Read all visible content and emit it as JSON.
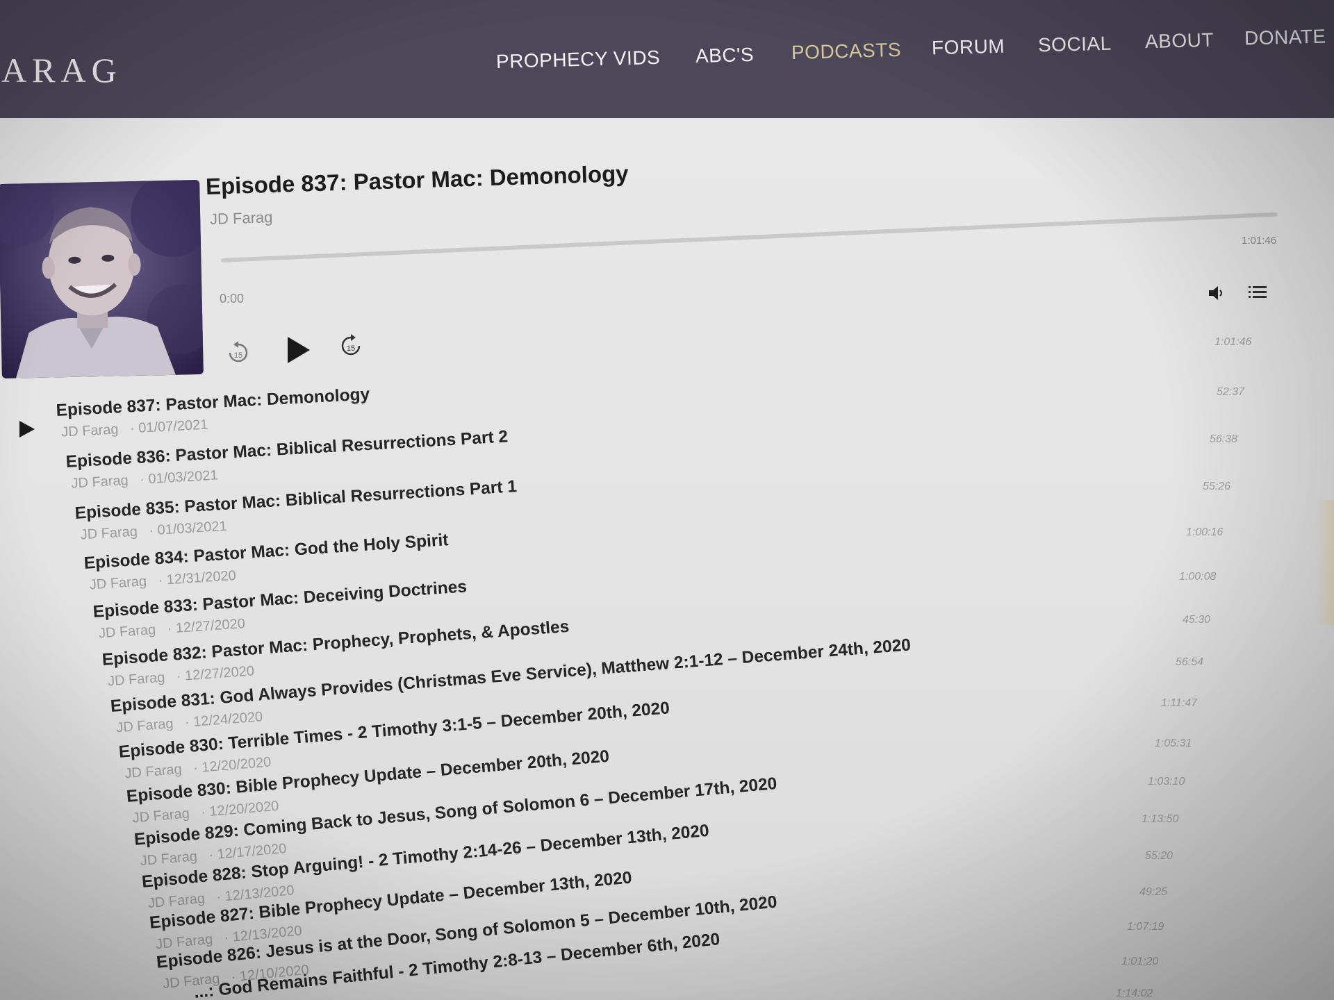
{
  "header": {
    "logo": "ARAG",
    "nav": [
      {
        "label": "PROPHECY VIDS",
        "active": false
      },
      {
        "label": "ABC'S",
        "active": false
      },
      {
        "label": "PODCASTS",
        "active": true
      },
      {
        "label": "FORUM",
        "active": false
      },
      {
        "label": "SOCIAL",
        "active": false
      },
      {
        "label": "ABOUT",
        "active": false
      },
      {
        "label": "DONATE",
        "active": false
      }
    ]
  },
  "player": {
    "title": "Episode 837: Pastor Mac: Demonology",
    "artist": "JD Farag",
    "time_current": "0:00",
    "time_total": "1:01:46",
    "progress": 0,
    "icons": [
      "rewind-15-icon",
      "play-icon",
      "forward-15-icon",
      "volume-icon",
      "playlist-icon"
    ]
  },
  "episodes": [
    {
      "title": "Episode 837: Pastor Mac: Demonology",
      "artist": "JD Farag",
      "date": "· 01/07/2021",
      "duration": "1:01:46"
    },
    {
      "title": "Episode 836: Pastor Mac: Biblical Resurrections Part 2",
      "artist": "JD Farag",
      "date": "· 01/03/2021",
      "duration": "52:37"
    },
    {
      "title": "Episode 835: Pastor Mac: Biblical Resurrections Part 1",
      "artist": "JD Farag",
      "date": "· 01/03/2021",
      "duration": "56:38"
    },
    {
      "title": "Episode 834: Pastor Mac: God the Holy Spirit",
      "artist": "JD Farag",
      "date": "· 12/31/2020",
      "duration": "55:26"
    },
    {
      "title": "Episode 833: Pastor Mac: Deceiving Doctrines",
      "artist": "JD Farag",
      "date": "· 12/27/2020",
      "duration": "1:00:16"
    },
    {
      "title": "Episode 832: Pastor Mac: Prophecy, Prophets, & Apostles",
      "artist": "JD Farag",
      "date": "· 12/27/2020",
      "duration": "1:00:08"
    },
    {
      "title": "Episode 831: God Always Provides (Christmas Eve Service), Matthew 2:1-12 – December 24th, 2020",
      "artist": "JD Farag",
      "date": "· 12/24/2020",
      "duration": "45:30"
    },
    {
      "title": "Episode 830: Terrible Times - 2 Timothy 3:1-5 – December 20th, 2020",
      "artist": "JD Farag",
      "date": "· 12/20/2020",
      "duration": "56:54"
    },
    {
      "title": "Episode 830: Bible Prophecy Update – December 20th, 2020",
      "artist": "JD Farag",
      "date": "· 12/20/2020",
      "duration": "1:11:47"
    },
    {
      "title": "Episode 829: Coming Back to Jesus, Song of Solomon 6 – December 17th, 2020",
      "artist": "JD Farag",
      "date": "· 12/17/2020",
      "duration": "1:05:31"
    },
    {
      "title": "Episode 828: Stop Arguing! - 2 Timothy 2:14-26 – December 13th, 2020",
      "artist": "JD Farag",
      "date": "· 12/13/2020",
      "duration": "1:03:10"
    },
    {
      "title": "Episode 827: Bible Prophecy Update – December 13th, 2020",
      "artist": "JD Farag",
      "date": "· 12/13/2020",
      "duration": "1:13:50"
    },
    {
      "title": "Episode 826: Jesus is at the Door, Song of Solomon 5 – December 10th, 2020",
      "artist": "JD Farag",
      "date": "· 12/10/2020",
      "duration": "55:20"
    },
    {
      "title": "...: God Remains Faithful - 2 Timothy 2:8-13 – December 6th, 2020",
      "artist": "",
      "date": "",
      "duration": "49:25"
    }
  ],
  "extra_durations": [
    "1:07:19",
    "1:01:20",
    "1:14:02"
  ]
}
